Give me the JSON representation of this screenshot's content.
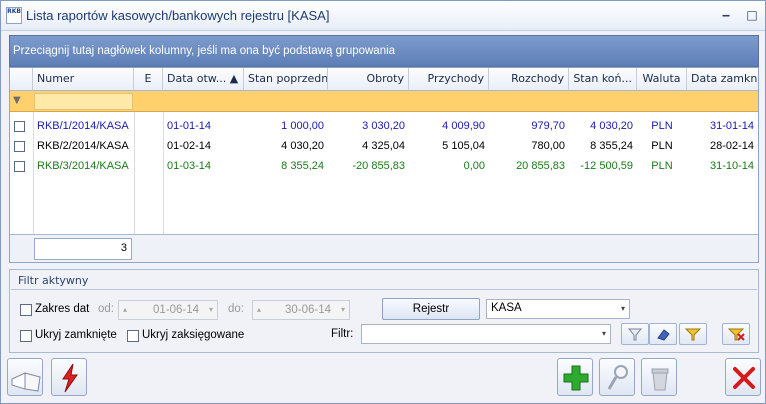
{
  "window": {
    "title": "Lista raportów kasowych/bankowych rejestru [KASA]",
    "app_icon_text": "RKB"
  },
  "group_bar": {
    "text": "Przeciągnij tutaj nagłówek kolumny, jeśli ma ona być podstawą grupowania"
  },
  "grid": {
    "columns": [
      "Numer",
      "E",
      "Data otw... ▲",
      "Stan poprzedni",
      "Obroty",
      "Przychody",
      "Rozchody",
      "Stan koń...",
      "Waluta",
      "Data zamkn."
    ],
    "rows": [
      {
        "color": "#1a1ab0",
        "cells": [
          "RKB/1/2014/KASA",
          "",
          "01-01-14",
          "1 000,00",
          "3 030,20",
          "4 009,90",
          "979,70",
          "4 030,20",
          "PLN",
          "31-01-14"
        ]
      },
      {
        "color": "#000000",
        "cells": [
          "RKB/2/2014/KASA",
          "",
          "01-02-14",
          "4 030,20",
          "4 325,04",
          "5 105,04",
          "780,00",
          "8 355,24",
          "PLN",
          "28-02-14"
        ]
      },
      {
        "color": "#1a7a1a",
        "cells": [
          "RKB/3/2014/KASA",
          "",
          "01-03-14",
          "8 355,24",
          "-20 855,83",
          "0,00",
          "20 855,83",
          "-12 500,59",
          "PLN",
          "31-10-14"
        ]
      }
    ],
    "count": "3"
  },
  "filter_panel": {
    "title": "Filtr aktywny",
    "zakres_dat": "Zakres dat",
    "od_label": "od:",
    "od_value": "01-06-14",
    "do_label": "do:",
    "do_value": "30-06-14",
    "rejestr_button": "Rejestr",
    "rejestr_value": "KASA",
    "ukryj_zamkniete": "Ukryj zamknięte",
    "ukryj_zaksiegowane": "Ukryj zaksięgowane",
    "filtr_label": "Filtr:",
    "filtr_value": ""
  },
  "colors": {
    "filter_row": "#ffd06b",
    "group_bar": "#6a8bc1",
    "add_green": "#2eaa2e",
    "close_red": "#d41c1c"
  }
}
